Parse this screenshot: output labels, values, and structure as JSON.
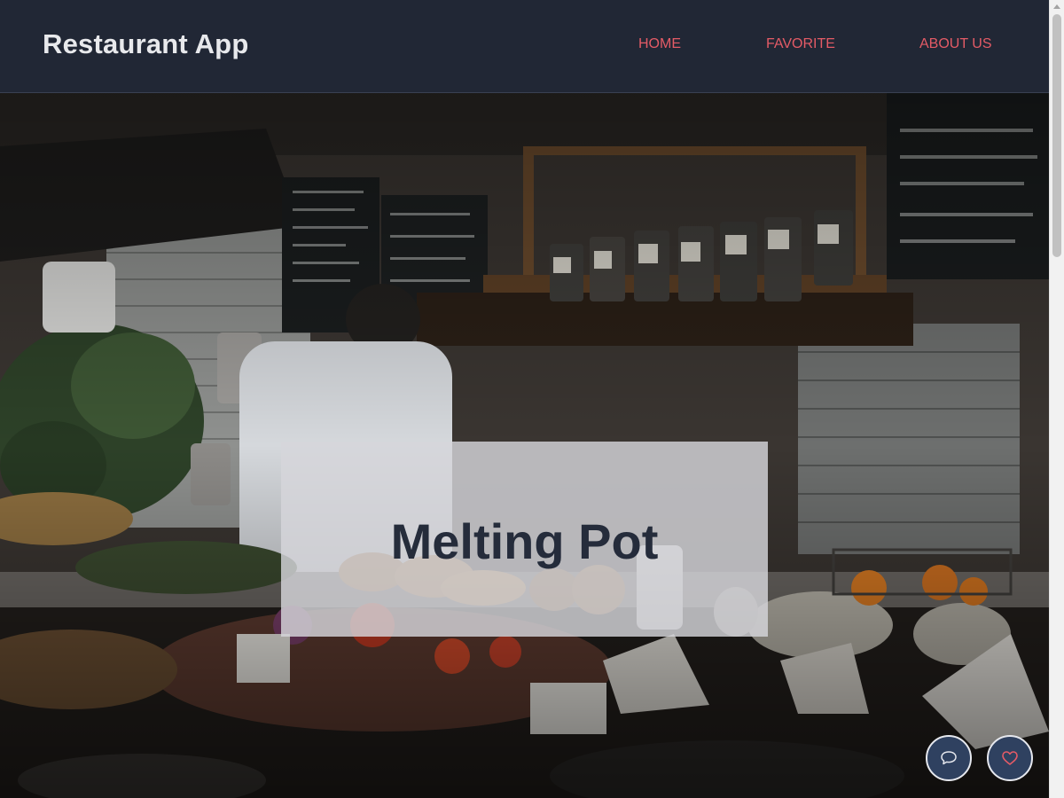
{
  "app": {
    "title": "Restaurant App"
  },
  "nav": {
    "home": "HOME",
    "favorite": "FAVORITE",
    "about": "ABOUT US"
  },
  "hero": {
    "title": "Melting Pot"
  },
  "fabs": {
    "chat": "chat-bubble-icon",
    "favorite": "heart-icon"
  },
  "colors": {
    "header_bg": "#212735",
    "nav_link": "#e45b66",
    "title_text": "#252c3b",
    "fab_bg": "#2f4160",
    "heart": "#e45b66"
  }
}
